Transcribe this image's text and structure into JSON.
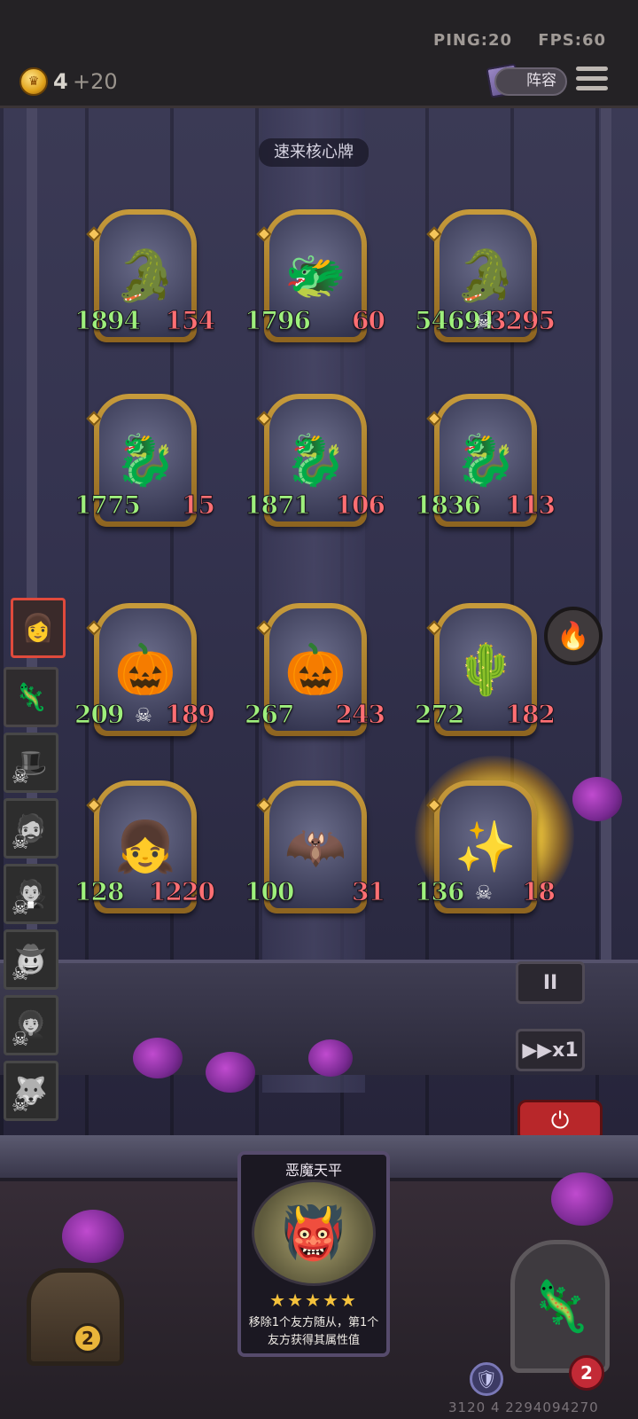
{
  "status": {
    "ping": "PING:20",
    "fps": "FPS:60"
  },
  "currency": {
    "gold": "4",
    "income": "+20"
  },
  "header": {
    "lineup_label": "阵容",
    "lineup_icon": "book-icon",
    "menu_icon": "hamburger-menu-icon"
  },
  "board": {
    "hint": "速来核心牌",
    "rows": [
      [
        {
          "attack": "1894",
          "health": "154",
          "icon": "🐊"
        },
        {
          "attack": "1796",
          "health": "60",
          "icon": "🐲"
        },
        {
          "attack": "54691",
          "health": "3295",
          "icon": "🐊",
          "skull": true
        }
      ],
      [
        {
          "attack": "1775",
          "health": "15",
          "icon": "🐉"
        },
        {
          "attack": "1871",
          "health": "106",
          "icon": "🐉"
        },
        {
          "attack": "1836",
          "health": "113",
          "icon": "🐉"
        }
      ],
      [
        {
          "attack": "209",
          "health": "189",
          "icon": "🎃",
          "skull": true
        },
        {
          "attack": "267",
          "health": "243",
          "icon": "🎃"
        },
        {
          "attack": "272",
          "health": "182",
          "icon": "🌵"
        }
      ],
      [
        {
          "attack": "128",
          "health": "1220",
          "icon": "👧"
        },
        {
          "attack": "100",
          "health": "31",
          "icon": "🦇"
        },
        {
          "attack": "136",
          "health": "18",
          "icon": "✨",
          "skull": true
        }
      ]
    ]
  },
  "roster": [
    {
      "icon": "👩",
      "active": true
    },
    {
      "icon": "🦎",
      "active": false
    },
    {
      "icon": "🎩",
      "dead": true
    },
    {
      "icon": "🧔",
      "dead": true
    },
    {
      "icon": "🧛",
      "dead": true
    },
    {
      "icon": "🤠",
      "dead": true
    },
    {
      "icon": "👩‍🦱",
      "dead": true
    },
    {
      "icon": "🐺",
      "dead": true
    }
  ],
  "controls": {
    "pause_label": "II",
    "speed_label": "▶▶x1",
    "power_icon": "⏻",
    "lighter_icon": "🔥"
  },
  "spell": {
    "title": "恶魔天平",
    "art_icon": "👹",
    "stars": "★★★★★",
    "description": "移除1个友方随从，第1个友方获得其属性值"
  },
  "bottom": {
    "chest_count": "2",
    "hero_icon": "🦎",
    "armor_icon": "🛡",
    "lives": "2",
    "debug": "3120 4 2294094270"
  },
  "colors": {
    "attack": "#9ef07c",
    "health": "#ff6f73",
    "frame_gold": "#c79b3b"
  }
}
